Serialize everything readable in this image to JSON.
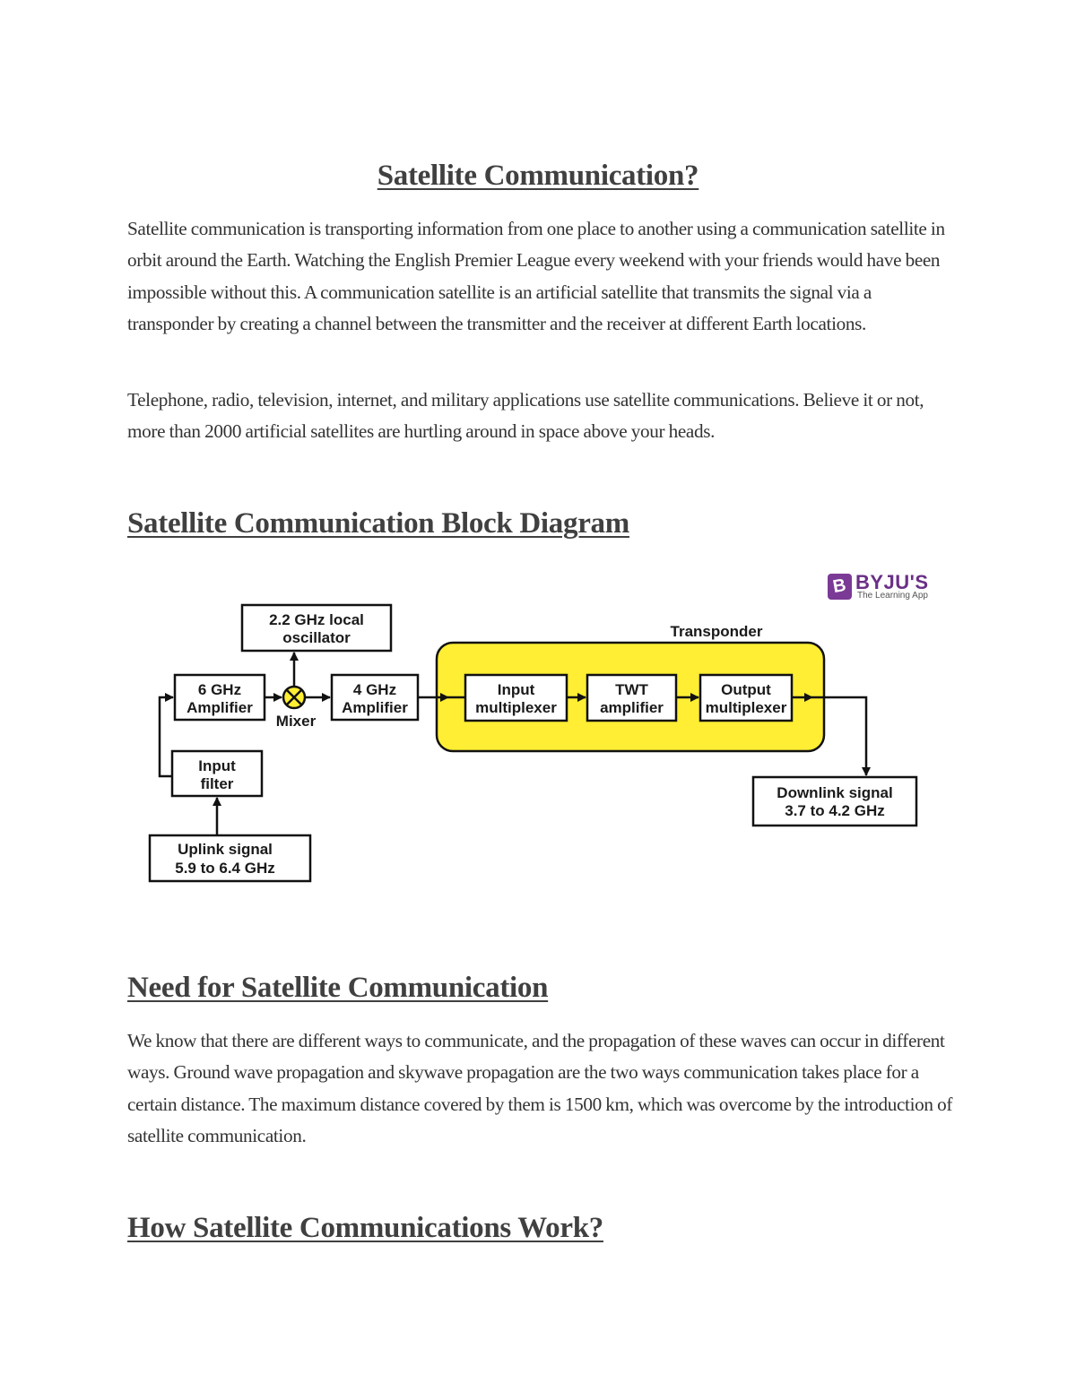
{
  "document": {
    "title": "Satellite Communication?",
    "intro_paragraphs": [
      "Satellite communication is transporting information from one place to another using a communication satellite in orbit around the Earth. Watching the English Premier League every weekend with your friends would have been impossible without this. A communication satellite is an artificial satellite that transmits the signal via a transponder by creating a channel between the transmitter and the receiver at different Earth locations.",
      "Telephone, radio, television, internet, and military applications use satellite communications. Believe it or not, more than 2000 artificial satellites are hurtling around in space above your heads."
    ],
    "sections": [
      {
        "heading": "Satellite Communication Block Diagram"
      },
      {
        "heading": "Need for Satellite Communication",
        "paragraph": "We know that there are different ways to communicate, and the propagation of these waves can occur in different ways. Ground wave propagation and skywave propagation are the two ways communication takes place for a certain distance. The maximum distance covered by them is 1500 km, which was overcome by the introduction of satellite communication."
      },
      {
        "heading": "How Satellite Communications Work?"
      }
    ]
  },
  "logo": {
    "mark": "B",
    "name": "BYJU'S",
    "tagline": "The Learning App",
    "color": "#7b3a96"
  },
  "diagram": {
    "transponder_label": "Transponder",
    "transponder_color": "#ffee33",
    "mixer_label": "Mixer",
    "mixer_color": "#ffee33",
    "blocks": {
      "oscillator": [
        "2.2 GHz local",
        "oscillator"
      ],
      "amp6": [
        "6 GHz",
        "Amplifier"
      ],
      "amp4": [
        "4 GHz",
        "Amplifier"
      ],
      "input_filter": [
        "Input",
        "filter"
      ],
      "uplink": [
        "Uplink signal",
        "5.9 to 6.4 GHz"
      ],
      "input_mux": [
        "Input",
        "multiplexer"
      ],
      "twt": [
        "TWT",
        "amplifier"
      ],
      "output_mux": [
        "Output",
        "multiplexer"
      ],
      "downlink": [
        "Downlink signal",
        "3.7 to 4.2 GHz"
      ]
    }
  }
}
